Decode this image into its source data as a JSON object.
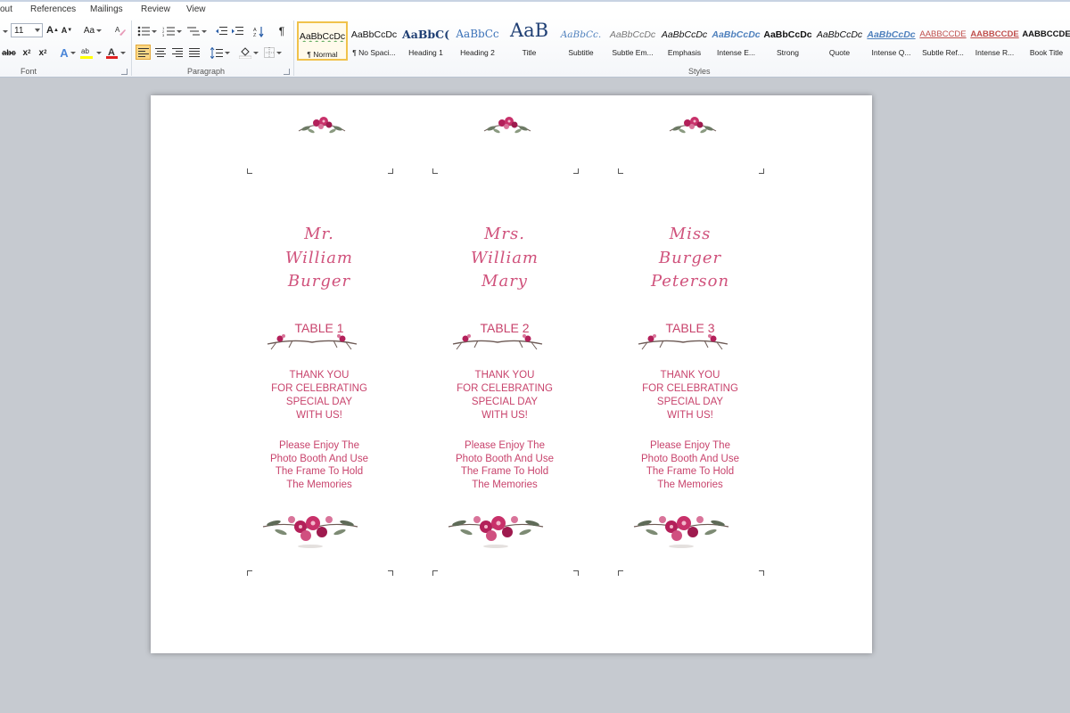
{
  "ribbon": {
    "tabs": [
      "out",
      "References",
      "Mailings",
      "Review",
      "View"
    ],
    "font_size": "11",
    "groups": {
      "font": "Font",
      "paragraph": "Paragraph",
      "styles": "Styles"
    },
    "styles": [
      {
        "sample": "AaBbCcDc",
        "name": "¶ Normal"
      },
      {
        "sample": "AaBbCcDc",
        "name": "¶ No Spaci..."
      },
      {
        "sample": "AaBbC(",
        "name": "Heading 1"
      },
      {
        "sample": "AaBbCc",
        "name": "Heading 2"
      },
      {
        "sample": "AaB",
        "name": "Title"
      },
      {
        "sample": "AaBbCc.",
        "name": "Subtitle"
      },
      {
        "sample": "AaBbCcDc",
        "name": "Subtle Em..."
      },
      {
        "sample": "AaBbCcDc",
        "name": "Emphasis"
      },
      {
        "sample": "AaBbCcDc",
        "name": "Intense E..."
      },
      {
        "sample": "AaBbCcDc",
        "name": "Strong"
      },
      {
        "sample": "AaBbCcDc",
        "name": "Quote"
      },
      {
        "sample": "AaBbCcDc",
        "name": "Intense Q..."
      },
      {
        "sample": "AABBCCDE",
        "name": "Subtle Ref..."
      },
      {
        "sample": "AABBCCDE",
        "name": "Intense R..."
      },
      {
        "sample": "AABBCCDE",
        "name": "Book Title"
      }
    ]
  },
  "document": {
    "cards": [
      {
        "name_lines": [
          "Mr.",
          "William",
          "Burger"
        ],
        "table": "TABLE 1",
        "thanks": [
          "THANK YOU",
          "FOR CELEBRATING",
          "SPECIAL DAY",
          "WITH US!"
        ],
        "note": [
          "Please Enjoy The",
          "Photo Booth And Use",
          "The Frame To Hold",
          "The Memories"
        ]
      },
      {
        "name_lines": [
          "Mrs.",
          "William",
          "Mary"
        ],
        "table": "TABLE 2",
        "thanks": [
          "THANK YOU",
          "FOR CELEBRATING",
          "SPECIAL DAY",
          "WITH US!"
        ],
        "note": [
          "Please Enjoy The",
          "Photo Booth And Use",
          "The Frame To Hold",
          "The Memories"
        ]
      },
      {
        "name_lines": [
          "Miss",
          "Burger",
          "Peterson"
        ],
        "table": "TABLE 3",
        "thanks": [
          "THANK YOU",
          "FOR CELEBRATING",
          "SPECIAL DAY",
          "WITH US!"
        ],
        "note": [
          "Please Enjoy The",
          "Photo Booth And Use",
          "The Frame To Hold",
          "The Memories"
        ]
      }
    ]
  },
  "colors": {
    "accent": "#c8436c",
    "name_script": "#d0527c",
    "leaf": "#6d5a55",
    "flower": "#b3205a"
  }
}
